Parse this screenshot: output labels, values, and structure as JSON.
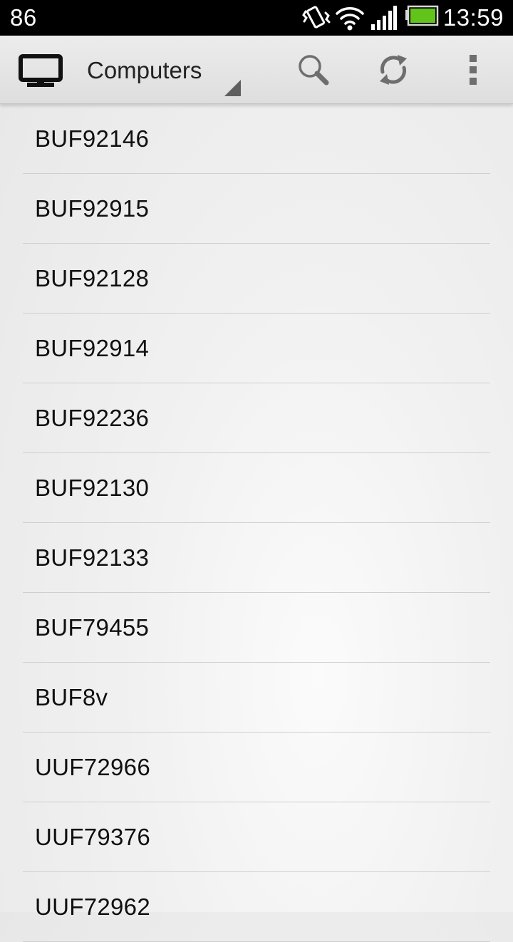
{
  "status_bar": {
    "left_text": "86",
    "time": "13:59",
    "icons": [
      "vibrate-icon",
      "wifi-icon",
      "signal-icon",
      "battery-icon"
    ],
    "battery_color": "#62c31a"
  },
  "action_bar": {
    "title": "Computers",
    "app_icon": "monitor-icon",
    "actions": [
      "search-icon",
      "refresh-icon",
      "overflow-menu-icon"
    ]
  },
  "computers": [
    {
      "name": "BUF92146"
    },
    {
      "name": "BUF92915"
    },
    {
      "name": "BUF92128"
    },
    {
      "name": "BUF92914"
    },
    {
      "name": "BUF92236"
    },
    {
      "name": "BUF92130"
    },
    {
      "name": "BUF92133"
    },
    {
      "name": "BUF79455"
    },
    {
      "name": "BUF8v"
    },
    {
      "name": "UUF72966"
    },
    {
      "name": "UUF79376"
    },
    {
      "name": "UUF72962"
    }
  ]
}
